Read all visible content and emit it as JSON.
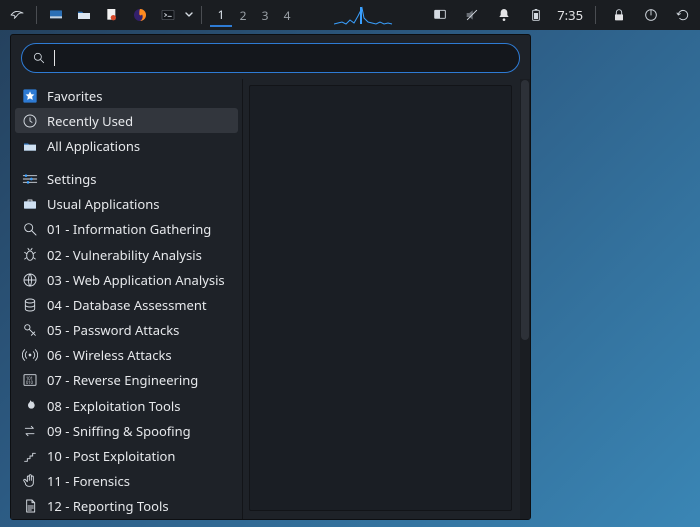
{
  "panel": {
    "workspaces": [
      "1",
      "2",
      "3",
      "4"
    ],
    "active_workspace": 0,
    "clock": "7:35",
    "launchers": [
      {
        "name": "kali-menu-icon"
      },
      {
        "name": "show-desktop-icon"
      },
      {
        "name": "file-manager-icon"
      },
      {
        "name": "text-editor-icon"
      },
      {
        "name": "firefox-icon"
      },
      {
        "name": "terminal-icon"
      }
    ],
    "tray": [
      {
        "name": "workspace-overview-icon"
      },
      {
        "name": "volume-muted-icon"
      },
      {
        "name": "notifications-icon"
      },
      {
        "name": "battery-icon"
      }
    ],
    "tray_right": [
      {
        "name": "lock-icon"
      },
      {
        "name": "power-icon"
      },
      {
        "name": "refresh-icon"
      }
    ]
  },
  "menu": {
    "search_value": "",
    "search_placeholder": "",
    "categories": [
      {
        "icon": "star",
        "label": "Favorites"
      },
      {
        "icon": "clock",
        "label": "Recently Used",
        "selected": true
      },
      {
        "icon": "grid",
        "label": "All Applications"
      },
      {
        "icon": "sliders",
        "label": "Settings",
        "gap": true
      },
      {
        "icon": "briefcase",
        "label": "Usual Applications"
      },
      {
        "icon": "magnifier",
        "label": "01 - Information Gathering"
      },
      {
        "icon": "bug",
        "label": "02 - Vulnerability Analysis"
      },
      {
        "icon": "globe",
        "label": "03 - Web Application Analysis"
      },
      {
        "icon": "db",
        "label": "04 - Database Assessment"
      },
      {
        "icon": "key",
        "label": "05 - Password Attacks"
      },
      {
        "icon": "antenna",
        "label": "06 - Wireless Attacks"
      },
      {
        "icon": "binary",
        "label": "07 - Reverse Engineering"
      },
      {
        "icon": "flame",
        "label": "08 - Exploitation Tools"
      },
      {
        "icon": "swap",
        "label": "09 - Sniffing & Spoofing"
      },
      {
        "icon": "stairs",
        "label": "10 - Post Exploitation"
      },
      {
        "icon": "hand",
        "label": "11 - Forensics"
      },
      {
        "icon": "doc",
        "label": "12 - Reporting Tools"
      }
    ]
  }
}
